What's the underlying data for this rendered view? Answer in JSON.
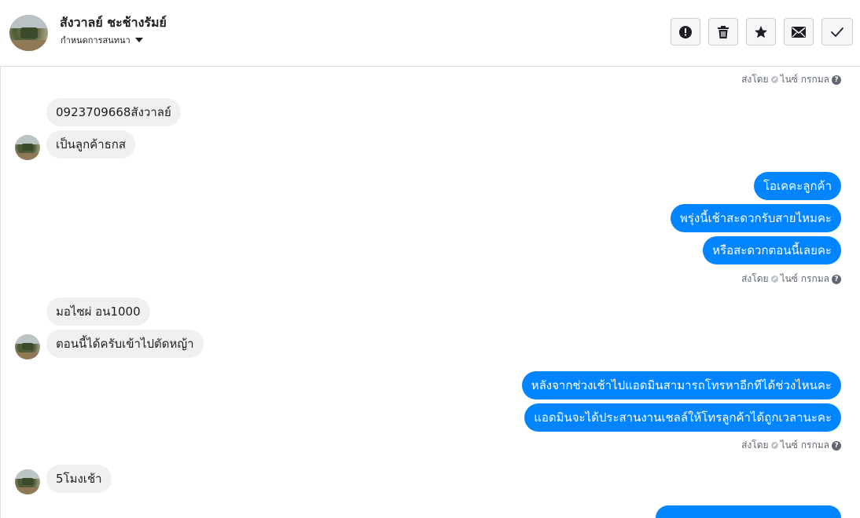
{
  "header": {
    "name": "สังวาลย์ ชะช้างรัมย์",
    "subtitle": "กำหนดการสนทนา",
    "actions": [
      {
        "icon": "alert-icon"
      },
      {
        "icon": "trash-icon"
      },
      {
        "icon": "star-icon"
      },
      {
        "icon": "envelope-icon"
      },
      {
        "icon": "check-icon"
      }
    ]
  },
  "seen": {
    "label": "ส่งโดย",
    "sender": "ไนซ์ กรกมล",
    "help": "?"
  },
  "messages": {
    "in1": "0923709668สังวาลย์",
    "in2": "เป็นลูกค้าธกส",
    "out1": "โอเคคะลูกค้า",
    "out2": "พรุ่งนี้เช้าสะดวกรับสายไหมคะ",
    "out3": "หรือสะดวกตอนนี้เลยคะ",
    "in3": "มอไซผ่ อน1000",
    "in4": "ตอนนี้ได้ครับเข้าไปตัดหญ้า",
    "out4": "หลังจากช่วงเช้าไปแอดมินสามารถโทรหาอีกทีได้ช่วงไหนคะ",
    "out5": "แอดมินจะได้ประสานงานเชลล์ให้โทรลูกค้าได้ถูกเวลานะคะ",
    "in5": "5โมงเช้า",
    "out6": ""
  },
  "colors": {
    "outgoing_bubble": "#0084ff",
    "incoming_bubble": "#f1f0f0"
  }
}
